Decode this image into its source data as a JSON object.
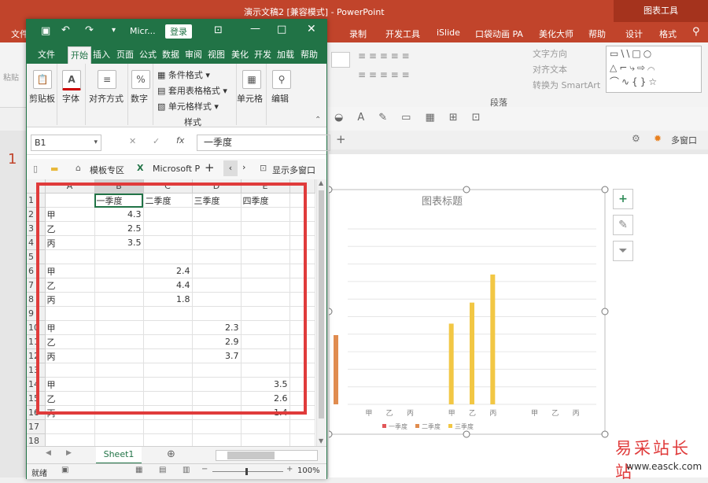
{
  "ppt": {
    "title": "演示文稿2 [兼容模式] - PowerPoint",
    "contextual_tab": "图表工具",
    "file_label": "文件",
    "tabs": [
      "录制",
      "开发工具",
      "iSlide",
      "口袋动画 PA",
      "美化大师",
      "帮助",
      "设计",
      "格式"
    ],
    "ribbon": {
      "text_direction": "文字方向",
      "align_text": "对齐文本",
      "convert_smartart": "转换为 SmartArt",
      "paragraph_group": "段落",
      "paste_partial": "粘贴",
      "multi_window": "多窗口"
    }
  },
  "excel": {
    "title_short": "Micr...",
    "login_button": "登录",
    "tabs": [
      "文件",
      "开始",
      "插入",
      "页面",
      "公式",
      "数据",
      "审阅",
      "视图",
      "美化",
      "开发",
      "加载",
      "帮助"
    ],
    "ribbon": {
      "clipboard": "剪贴板",
      "font": "字体",
      "alignment": "对齐方式",
      "number": "数字",
      "conditional_format": "条件格式",
      "table_format": "套用表格格式",
      "cell_style": "单元格样式",
      "style_group": "样式",
      "cells": "单元格",
      "editing": "编辑"
    },
    "name_box": "B1",
    "formula_value": "一季度",
    "doc_tabs": {
      "template": "模板专区",
      "workbook": "Microsoft P",
      "multi_window": "显示多窗口"
    },
    "columns": [
      "A",
      "B",
      "C",
      "D",
      "E"
    ],
    "rows": [
      [
        "",
        "一季度",
        "二季度",
        "三季度",
        "四季度"
      ],
      [
        "甲",
        "4.3",
        "",
        "",
        ""
      ],
      [
        "乙",
        "2.5",
        "",
        "",
        ""
      ],
      [
        "丙",
        "3.5",
        "",
        "",
        ""
      ],
      [
        "",
        "",
        "",
        "",
        ""
      ],
      [
        "甲",
        "",
        "2.4",
        "",
        ""
      ],
      [
        "乙",
        "",
        "4.4",
        "",
        ""
      ],
      [
        "丙",
        "",
        "1.8",
        "",
        ""
      ],
      [
        "",
        "",
        "",
        "",
        ""
      ],
      [
        "甲",
        "",
        "",
        "2.3",
        ""
      ],
      [
        "乙",
        "",
        "",
        "2.9",
        ""
      ],
      [
        "丙",
        "",
        "",
        "3.7",
        ""
      ],
      [
        "",
        "",
        "",
        "",
        ""
      ],
      [
        "甲",
        "",
        "",
        "",
        "3.5"
      ],
      [
        "乙",
        "",
        "",
        "",
        "2.6"
      ],
      [
        "丙",
        "",
        "",
        "",
        "1.4"
      ],
      [
        "",
        "",
        "",
        "",
        ""
      ],
      [
        "",
        "",
        "",
        "",
        ""
      ],
      [
        "",
        "",
        "",
        "",
        ""
      ],
      [
        "",
        "",
        "",
        "",
        ""
      ]
    ],
    "sheet_tab": "Sheet1",
    "status": "就绪",
    "zoom": "100%"
  },
  "chart_data": {
    "type": "bar",
    "title": "图表标题",
    "groups": [
      {
        "categories": [
          "甲",
          "乙",
          "丙"
        ],
        "values": [
          null,
          null,
          null
        ]
      },
      {
        "categories": [
          "甲",
          "乙",
          "丙"
        ],
        "values": [
          2.3,
          2.9,
          3.7
        ]
      },
      {
        "categories": [
          "甲",
          "乙",
          "丙"
        ],
        "values": [
          null,
          null,
          null
        ]
      }
    ],
    "series": [
      {
        "name": "一季度",
        "color": "#e15759"
      },
      {
        "name": "二季度",
        "color": "#e08c4f"
      },
      {
        "name": "三季度",
        "color": "#f2c744"
      }
    ],
    "ylim": [
      0,
      5
    ],
    "grid": true,
    "legend": "bottom"
  },
  "watermark": {
    "brand": "易采站长站",
    "url": "www.easck.com"
  }
}
